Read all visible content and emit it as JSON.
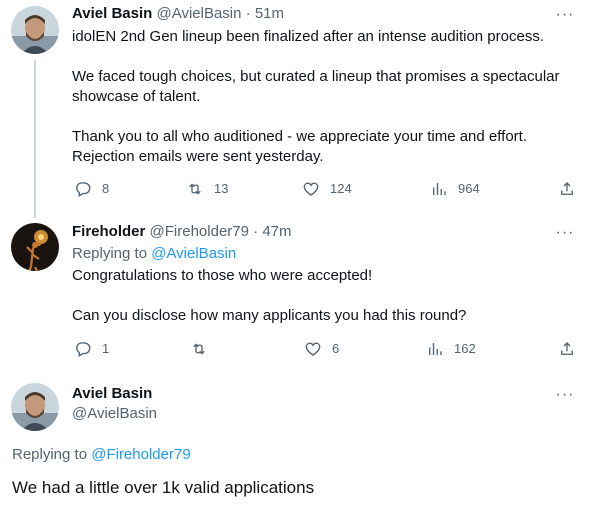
{
  "tweet1": {
    "name": "Aviel Basin",
    "handle": "@AvielBasin",
    "separator": "·",
    "time": "51m",
    "text_lines": [
      "idolEN 2nd Gen lineup been finalized after an intense audition process.",
      "",
      "We faced tough choices, but curated a lineup that promises a spectacular",
      "showcase of talent.",
      "",
      "Thank you to all who auditioned - we appreciate your time and effort.",
      "Rejection emails were sent yesterday."
    ],
    "replies": "8",
    "retweets": "13",
    "likes": "124",
    "views": "964"
  },
  "tweet2": {
    "name": "Fireholder",
    "handle": "@Fireholder79",
    "separator": "·",
    "time": "47m",
    "replying_prefix": "Replying to ",
    "replying_handle": "@AvielBasin",
    "text_lines": [
      "Congratulations to those who were accepted!",
      "",
      "Can you disclose how many applicants you had this round?"
    ],
    "replies": "1",
    "retweets": "",
    "likes": "6",
    "views": "162"
  },
  "tweet3": {
    "name": "Aviel Basin",
    "handle": "@AvielBasin",
    "replying_prefix": "Replying to ",
    "replying_handle": "@Fireholder79",
    "text": "We had a little over 1k valid applications"
  },
  "more_label": "···",
  "icons": [
    "reply-icon",
    "retweet-icon",
    "like-icon",
    "views-icon",
    "share-icon",
    "more-icon"
  ],
  "colors": {
    "link": "#1d9bf0",
    "muted": "#536471",
    "text": "#0f1419"
  }
}
